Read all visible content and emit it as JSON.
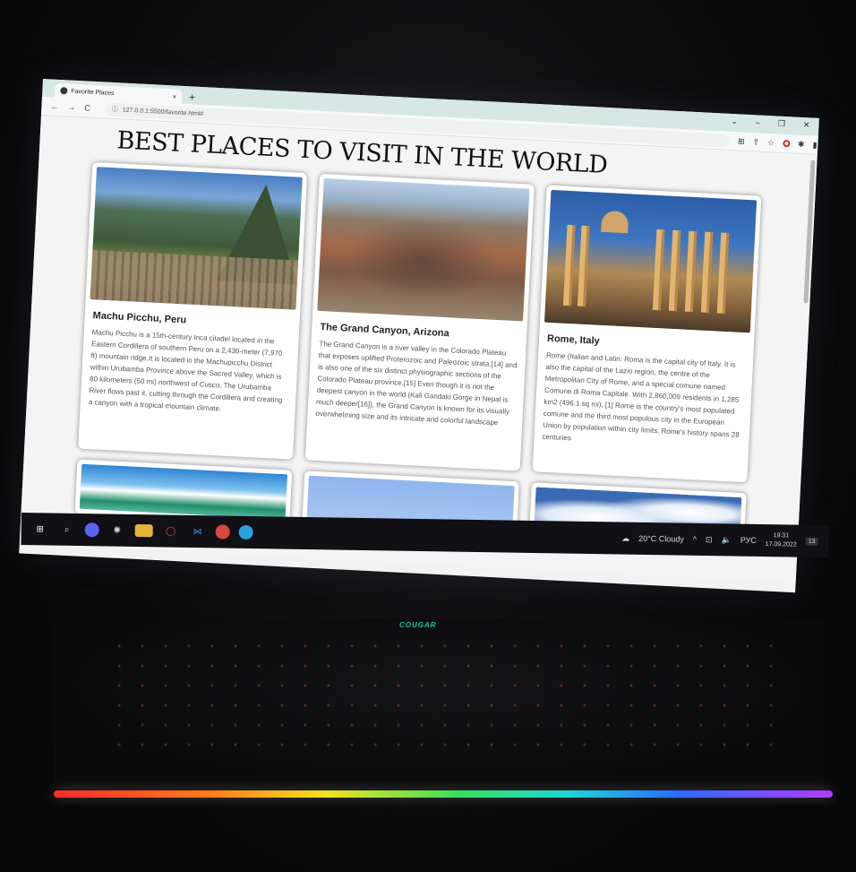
{
  "browser": {
    "tab_title": "Favorite Places",
    "tab_close": "×",
    "new_tab": "+",
    "url": "127.0.0.1:5500/favorite.html#",
    "nav_back": "←",
    "nav_forward": "→",
    "nav_reload": "C",
    "window_controls": [
      "⌄",
      "–",
      "❐",
      "✕"
    ]
  },
  "page": {
    "title": "BEST PLACES TO VISIT IN THE WORLD",
    "cards": [
      {
        "title": "Machu Picchu, Peru",
        "text": "Machu Picchu is a 15th-century Inca citadel located in the Eastern Cordillera of southern Peru on a 2,430-meter (7,970 ft) mountain ridge.It is located in the Machupicchu District within Urubamba Province above the Sacred Valley, which is 80 kilometers (50 mi) northwest of Cusco. The Urubamba River flows past it, cutting through the Cordillera and creating a canyon with a tropical mountain climate."
      },
      {
        "title": "The Grand Canyon, Arizona",
        "text": "The Grand Canyon is a river valley in the Colorado Plateau that exposes uplifted Proterozoic and Paleozoic strata.[14] and is also one of the six distinct physiographic sections of the Colorado Plateau province.[15] Even though it is not the deepest canyon in the world (Kali Gandaki Gorge in Nepal is much deeper[16]), the Grand Canyon is known for its visually overwhelming size and its intricate and colorful landscape"
      },
      {
        "title": "Rome, Italy",
        "text": "Rome (Italian and Latin: Roma is the capital city of Italy. It is also the capital of the Lazio region, the centre of the Metropolitan City of Rome, and a special comune named Comune di Roma Capitale. With 2,860,009 residents in 1,285 km2 (496.1 sq mi), [1] Rome is the country's most populated comune and the third most populous city in the European Union by population within city limits. Rome's history spans 28 centuries"
      }
    ]
  },
  "taskbar": {
    "weather": "20°C Cloudy",
    "language": "РУС",
    "time": "19:31",
    "date": "17.09.2022",
    "notifications": "13"
  },
  "laptop": {
    "brand": "COUGAR"
  }
}
